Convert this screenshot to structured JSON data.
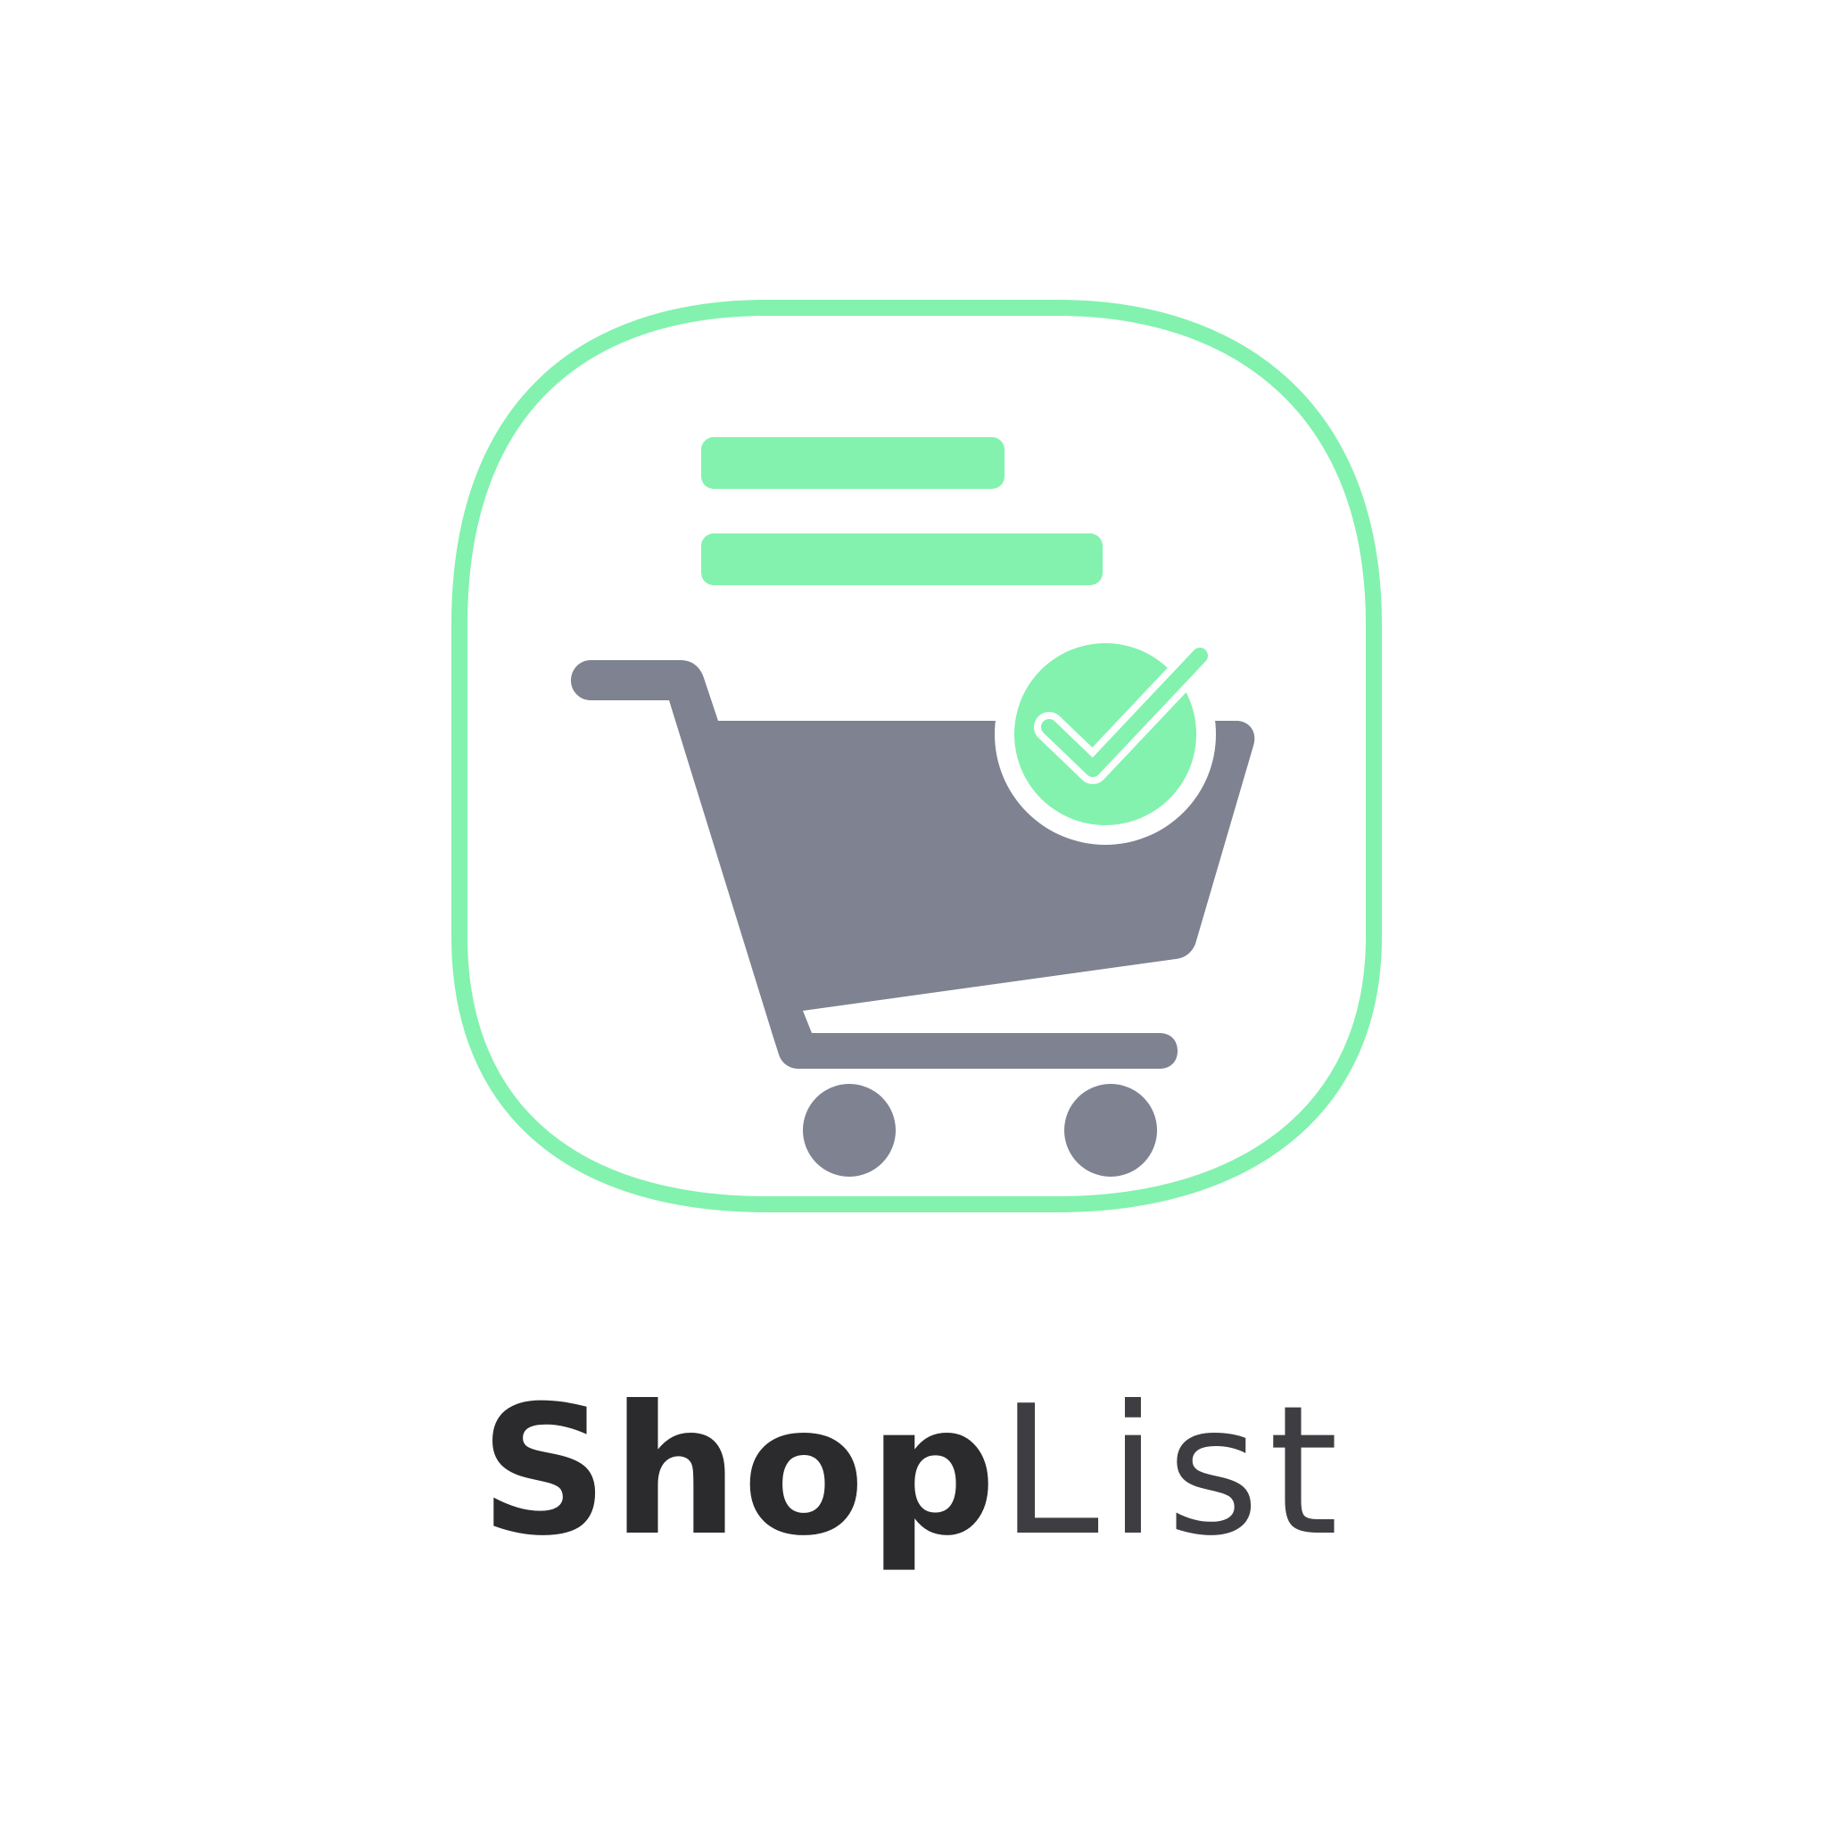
{
  "brand": {
    "name_bold": "Shop",
    "name_light": "List"
  },
  "icons": {
    "frame": "rounded-square-outline",
    "list": "list-lines-icon",
    "cart": "shopping-cart-icon",
    "check": "checkmark-badge-icon"
  },
  "colors": {
    "accent_green": "#82F2AE",
    "cart_gray": "#7E8291",
    "text_bold": "#2B2B2D",
    "text_light": "#3E3E42",
    "background": "#FFFFFF"
  }
}
